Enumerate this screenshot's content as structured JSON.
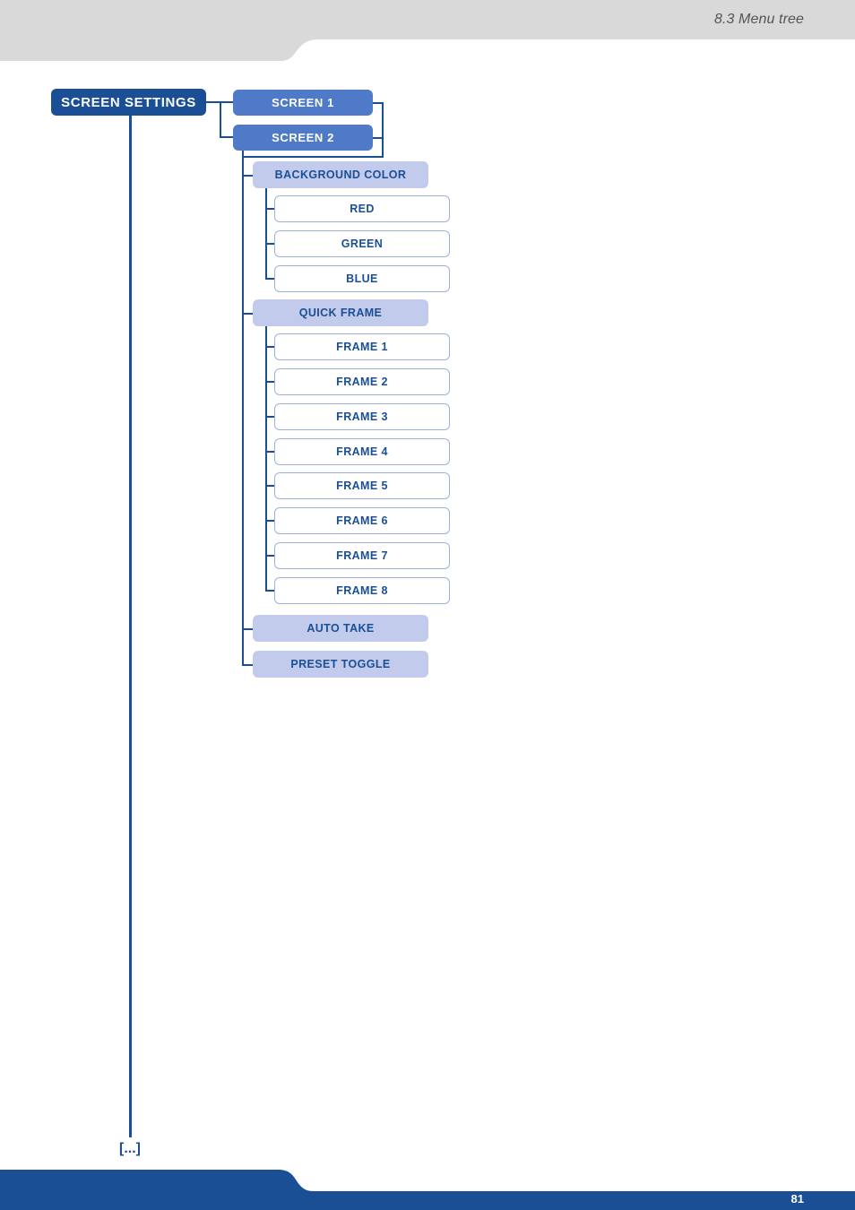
{
  "header": {
    "section_title": "8.3 Menu tree",
    "band_color": "#d9d9d9"
  },
  "footer": {
    "page_number": "81",
    "band_color": "#1a4f96"
  },
  "colors": {
    "root": "#1a4f96",
    "screen": "#4f7ac8",
    "submenu": "#c2cbec",
    "option_border": "#9db0de",
    "text_dark": "#1a4f96"
  },
  "tree": {
    "root": "SCREEN SETTINGS",
    "screens": [
      "SCREEN 1",
      "SCREEN 2"
    ],
    "submenus": [
      {
        "label": "BACKGROUND COLOR",
        "options": [
          "RED",
          "GREEN",
          "BLUE"
        ]
      },
      {
        "label": "QUICK FRAME",
        "options": [
          "FRAME 1",
          "FRAME 2",
          "FRAME 3",
          "FRAME 4",
          "FRAME 5",
          "FRAME 6",
          "FRAME 7",
          "FRAME 8"
        ]
      },
      {
        "label": "AUTO TAKE",
        "options": []
      },
      {
        "label": "PRESET TOGGLE",
        "options": []
      }
    ],
    "continuation": "[...]"
  }
}
